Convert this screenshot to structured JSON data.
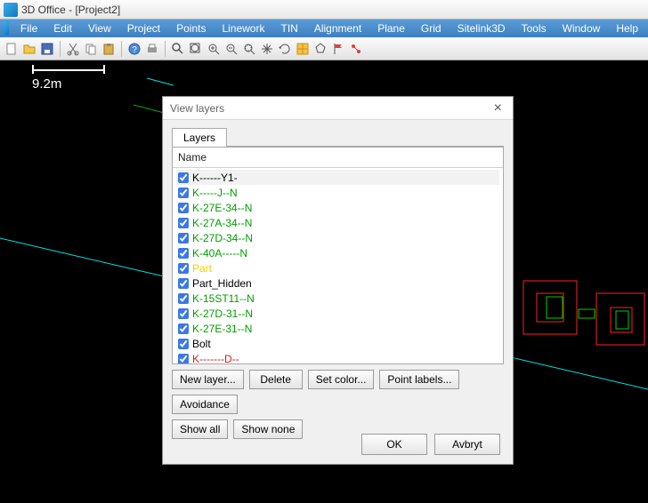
{
  "title": "3D Office - [Project2]",
  "scale_label": "9.2m",
  "menu": [
    "File",
    "Edit",
    "View",
    "Project",
    "Points",
    "Linework",
    "TIN",
    "Alignment",
    "Plane",
    "Grid",
    "Sitelink3D",
    "Tools",
    "Window",
    "Help"
  ],
  "toolbar_icons": [
    "new",
    "open",
    "save",
    "cut",
    "copy",
    "paste",
    "help",
    "print",
    "find",
    "zoom-extents",
    "zoom-in",
    "zoom-out",
    "zoom-window",
    "pan",
    "rotate",
    "grid",
    "polygon",
    "flag",
    "measure"
  ],
  "dialog": {
    "title": "View layers",
    "tab": "Layers",
    "header": "Name",
    "layers": [
      {
        "name": "K------Y1-",
        "color": "black",
        "checked": true,
        "selected": true
      },
      {
        "name": "K-----J--N",
        "color": "green",
        "checked": true
      },
      {
        "name": "K-27E-34--N",
        "color": "green",
        "checked": true
      },
      {
        "name": "K-27A-34--N",
        "color": "green",
        "checked": true
      },
      {
        "name": "K-27D-34--N",
        "color": "green",
        "checked": true
      },
      {
        "name": "K-40A-----N",
        "color": "green",
        "checked": true
      },
      {
        "name": "Part",
        "color": "yellow",
        "checked": true
      },
      {
        "name": "Part_Hidden",
        "color": "black",
        "checked": true
      },
      {
        "name": "K-15ST11--N",
        "color": "green",
        "checked": true
      },
      {
        "name": "K-27D-31--N",
        "color": "green",
        "checked": true
      },
      {
        "name": "K-27E-31--N",
        "color": "green",
        "checked": true
      },
      {
        "name": "Bolt",
        "color": "black",
        "checked": true
      },
      {
        "name": "K-------D--",
        "color": "red",
        "checked": true
      }
    ],
    "buttons_row1": [
      "New layer...",
      "Delete",
      "Set color...",
      "Point labels...",
      "Avoidance"
    ],
    "buttons_row2": [
      "Show all",
      "Show none"
    ],
    "ok": "OK",
    "cancel": "Avbryt"
  }
}
